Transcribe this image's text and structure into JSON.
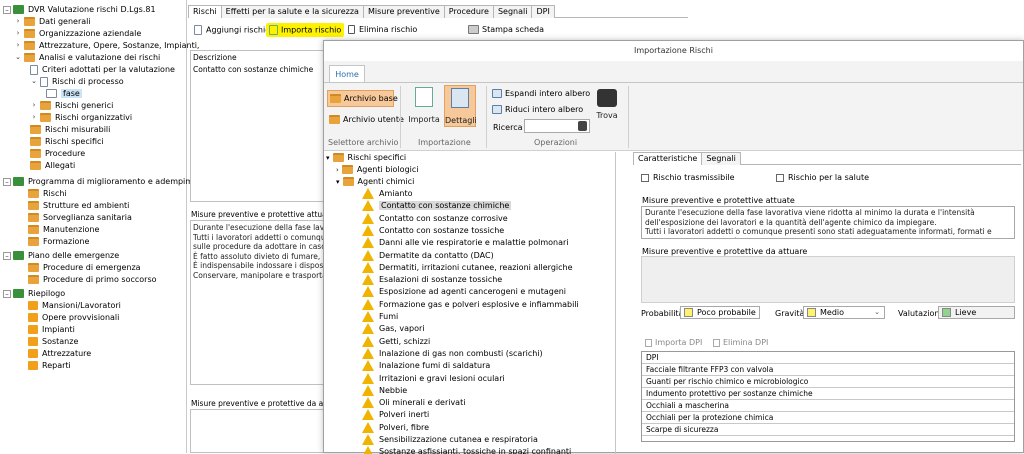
{
  "tree": {
    "root": "DVR Valutazione rischi D.Lgs.81",
    "items": [
      "Dati generali",
      "Organizzazione aziendale",
      "Attrezzature, Opere, Sostanze, Impianti,",
      "Analisi e valutazione dei rischi",
      "Criteri adottati per la valutazione",
      "Rischi di processo",
      "fase",
      "Rischi generici",
      "Rischi organizzativi",
      "Rischi misurabili",
      "Rischi specifici",
      "Procedure",
      "Allegati"
    ],
    "prog": "Programma di miglioramento e adempimenti",
    "prog_items": [
      "Rischi",
      "Strutture ed ambienti",
      "Sorveglianza sanitaria",
      "Manutenzione",
      "Formazione"
    ],
    "piano": "Piano delle emergenze",
    "piano_items": [
      "Procedure di emergenza",
      "Procedure di primo soccorso"
    ],
    "riep": "Riepilogo",
    "riep_items": [
      "Mansioni/Lavoratori",
      "Opere provvisionali",
      "Impianti",
      "Sostanze",
      "Attrezzature",
      "Reparti"
    ]
  },
  "main_tabs": [
    "Rischi",
    "Effetti per la salute e la sicurezza",
    "Misure preventive",
    "Procedure",
    "Segnali",
    "DPI"
  ],
  "toolbar": {
    "add": "Aggiungi rischio",
    "import": "Importa rischio",
    "delete": "Elimina rischio",
    "print": "Stampa scheda"
  },
  "left_panel": {
    "desc_label": "Descrizione",
    "desc_value": "Contatto con sostanze chimiche",
    "mis_label": "Misure preventive e protettive attuate",
    "mis_text": [
      "Durante l'esecuzione della fase lavorati",
      "Tutti i lavoratori addetti o comunque p",
      "sulle procedure da adottare in caso di e",
      "È fatto assoluto divieto di fumare, man",
      "È indispensabile indossare i dispositivi d",
      "Conservare, manipolare e trasportare g"
    ],
    "mis2_label": "Misure preventive e protettive da attua"
  },
  "dialog": {
    "title": "Importazione Rischi",
    "ribbon_tab": "Home",
    "archivio_base": "Archivio base",
    "archivio_utente": "Archivio utente",
    "group1": "Selettore archivio",
    "importa": "Importa",
    "dettagli": "Dettagli",
    "group2": "Importazione",
    "espandi": "Espandi intero albero",
    "riduci": "Riduci intero albero",
    "ricerca": "Ricerca",
    "trova": "Trova",
    "group3": "Operazioni"
  },
  "risk_tree": {
    "root": "Rischi specifici",
    "bio": "Agenti biologici",
    "chim": "Agenti chimici",
    "items": [
      "Amianto",
      "Contatto con sostanze chimiche",
      "Contatto con sostanze corrosive",
      "Contatto con sostanze tossiche",
      "Danni alle vie respiratorie e malattie polmonari",
      "Dermatite da contatto (DAC)",
      "Dermatiti, irritazioni cutanee, reazioni allergiche",
      "Esalazioni di sostanze tossiche",
      "Esposizione ad agenti cancerogeni e mutageni",
      "Formazione gas e polveri esplosive e infiammabili",
      "Fumi",
      "Gas, vapori",
      "Getti, schizzi",
      "Inalazione di gas non combusti (scarichi)",
      "Inalazione fumi di saldatura",
      "Irritazioni e gravi lesioni oculari",
      "Nebbie",
      "Oli minerali e derivati",
      "Polveri inerti",
      "Polveri, fibre",
      "Sensibilizzazione cutanea e respiratoria",
      "Sostanze asfissianti, tossiche in spazi confinanti"
    ]
  },
  "details": {
    "tabs": [
      "Caratteristiche",
      "Segnali"
    ],
    "cb1": "Rischio trasmissibile",
    "cb2": "Rischio per la salute",
    "mis_label": "Misure preventive e protettive attuate",
    "mis_text": "Durante l'esecuzione della fase lavorativa viene ridotta al minimo la durata e l'intensità dell'esposizione dei lavoratori e la quantità dell'agente chimico da impiegare.\nTutti i lavoratori addetti o comunque presenti sono stati adeguatamente informati, formati e addestrati sulle modalità di impiego e di deposito delle sostanze e dei preparati pericolosi, sui rischi per la salute connessi con",
    "mis2_label": "Misure preventive e protettive da attuare",
    "prob_label": "Probabilità",
    "prob_value": "Poco probabile",
    "prob_color": "#fff36b",
    "grav_label": "Gravità",
    "grav_value": "Medio",
    "grav_color": "#fff36b",
    "val_label": "Valutazione",
    "val_value": "Lieve",
    "val_color": "#8fd38f",
    "imp_dpi": "Importa DPI",
    "del_dpi": "Elimina DPI",
    "dpi": [
      "DPI",
      "Facciale filtrante FFP3 con valvola",
      "Guanti per rischio chimico e microbiologico",
      "Indumento protettivo per sostanze chimiche",
      "Occhiali a mascherina",
      "Occhiali per la protezione chimica",
      "Scarpe di sicurezza"
    ]
  }
}
